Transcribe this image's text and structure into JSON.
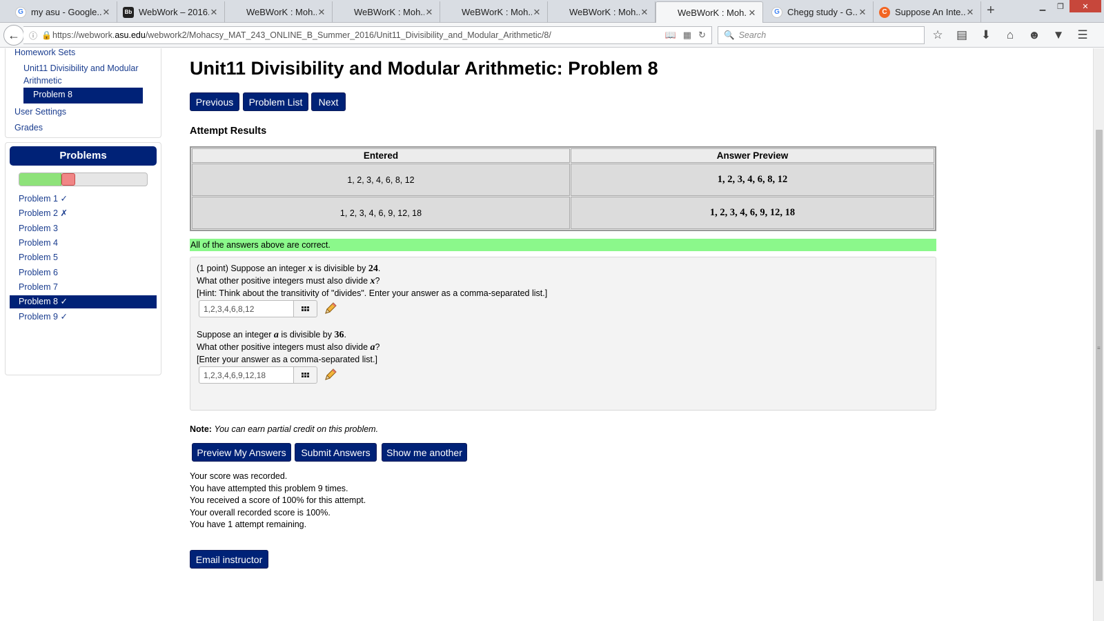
{
  "browser": {
    "tabs": [
      {
        "label": "my asu - Google...",
        "icon": "google-icon",
        "active": false
      },
      {
        "label": "WebWork – 2016...",
        "icon": "blackboard-icon",
        "active": false
      },
      {
        "label": "WeBWorK : Moh...",
        "icon": "none",
        "active": false
      },
      {
        "label": "WeBWorK : Moh...",
        "icon": "none",
        "active": false
      },
      {
        "label": "WeBWorK : Moh...",
        "icon": "none",
        "active": false
      },
      {
        "label": "WeBWorK : Moh...",
        "icon": "none",
        "active": false
      },
      {
        "label": "WeBWorK : Moh...",
        "icon": "none",
        "active": true
      },
      {
        "label": "Chegg study - G...",
        "icon": "google-icon",
        "active": false
      },
      {
        "label": "Suppose An Inte...",
        "icon": "chegg-icon",
        "active": false
      }
    ],
    "url_prefix": "https://webwork.",
    "url_domain": "asu.edu",
    "url_path": "/webwork2/Mohacsy_MAT_243_ONLINE_B_Summer_2016/Unit11_Divisibility_and_Modular_Arithmetic/8/",
    "search_placeholder": "Search"
  },
  "sidebar": {
    "homework_sets": "Homework Sets",
    "unit": "Unit11 Divisibility and Modular Arithmetic",
    "current_problem": "Problem 8",
    "user_settings": "User Settings",
    "grades": "Grades",
    "problems_header": "Problems",
    "progress": {
      "correct_fraction": 0.33,
      "incorrect_fraction": 0.11
    },
    "problem_list": [
      {
        "label": "Problem 1 ✓",
        "current": false
      },
      {
        "label": "Problem 2 ✗",
        "current": false
      },
      {
        "label": "Problem 3",
        "current": false
      },
      {
        "label": "Problem 4",
        "current": false
      },
      {
        "label": "Problem 5",
        "current": false
      },
      {
        "label": "Problem 6",
        "current": false
      },
      {
        "label": "Problem 7",
        "current": false
      },
      {
        "label": "Problem 8 ✓",
        "current": true
      },
      {
        "label": "Problem 9 ✓",
        "current": false
      }
    ]
  },
  "main": {
    "title": "Unit11 Divisibility and Modular Arithmetic: Problem 8",
    "nav_buttons": {
      "previous": "Previous",
      "problem_list": "Problem List",
      "next": "Next"
    },
    "attempt_results_heading": "Attempt Results",
    "results_table": {
      "headers": [
        "Entered",
        "Answer Preview"
      ],
      "rows": [
        {
          "entered": "1, 2, 3, 4, 6, 8, 12",
          "preview": "1, 2, 3, 4, 6, 8, 12"
        },
        {
          "entered": "1, 2, 3, 4, 6, 9, 12, 18",
          "preview": "1, 2, 3, 4, 6, 9, 12, 18"
        }
      ]
    },
    "correct_message": "All of the answers above are correct.",
    "problem": {
      "q1_prefix": "(1 point) Suppose an integer ",
      "q1_var": "x",
      "q1_mid": " is divisible by ",
      "q1_num": "24",
      "q1_end": ".",
      "q1_line2_prefix": "What other positive integers must also divide ",
      "q1_line2_end": "?",
      "q1_hint": "[Hint: Think about the transitivity of \"divides\". Enter your answer as a comma-separated list.]",
      "answer1": "1,2,3,4,6,8,12",
      "q2_prefix": "Suppose an integer ",
      "q2_var": "a",
      "q2_mid": " is divisible by ",
      "q2_num": "36",
      "q2_end": ".",
      "q2_line2_prefix": "What other positive integers must also divide ",
      "q2_line2_end": "?",
      "q2_hint": "[Enter your answer as a comma-separated list.]",
      "answer2": "1,2,3,4,6,9,12,18"
    },
    "note_label": "Note:",
    "note_text": "You can earn partial credit on this problem.",
    "action_buttons": {
      "preview": "Preview My Answers",
      "submit": "Submit Answers",
      "another": "Show me another"
    },
    "score_lines": [
      "Your score was recorded.",
      "You have attempted this problem 9 times.",
      "You received a score of 100% for this attempt.",
      "Your overall recorded score is 100%.",
      "You have 1 attempt remaining."
    ],
    "email_button": "Email instructor"
  },
  "colors": {
    "accent": "#002277",
    "correct_banner": "#8bf88b",
    "progress_good": "#8ee27a",
    "progress_bad": "#f08686"
  }
}
